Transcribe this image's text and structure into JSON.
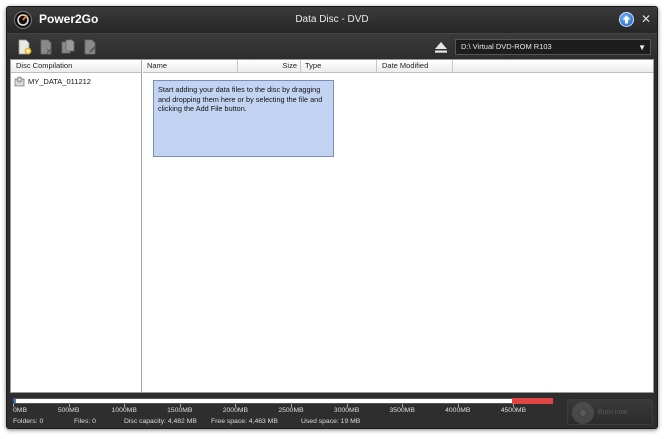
{
  "app": {
    "name": "Power2Go",
    "window_title": "Data Disc - DVD"
  },
  "icons": {
    "logo": "power2go-logo-icon",
    "upgrade": "upgrade-arrow-icon",
    "close": "close-icon",
    "add_file": "add-file-icon",
    "delete": "delete-icon",
    "copy": "copy-icon",
    "edit": "edit-icon",
    "eject": "eject-icon",
    "tree_disc": "disc-folder-icon",
    "burn": "disc-burn-icon"
  },
  "toolbar": {
    "drive": "D:\\ Virtual DVD-ROM R103"
  },
  "left_pane": {
    "header": "Disc Compilation",
    "items": [
      {
        "label": "MY_DATA_011212"
      }
    ]
  },
  "file_list": {
    "columns": [
      "Name",
      "Size",
      "Type",
      "Date Modified"
    ],
    "hint": "Start adding your data files to the disc by dragging and dropping them here or by selecting the file and clicking the Add File button."
  },
  "capacity_bar": {
    "ticks": [
      "0MB",
      "500MB",
      "1000MB",
      "1500MB",
      "2000MB",
      "2500MB",
      "3000MB",
      "3500MB",
      "4000MB",
      "4500MB"
    ],
    "used_fraction": 0.004
  },
  "status": {
    "folders": "Folders: 0",
    "files": "Files: 0",
    "capacity": "Disc capacity: 4,482 MB",
    "free": "Free space: 4,463 MB",
    "used": "Used space: 19 MB"
  },
  "burn": {
    "label": "Burn now"
  },
  "colors": {
    "accent": "#3d7bd9",
    "hint_bg": "#c3d4f2",
    "over_capacity": "#e04545",
    "title_bg": "#2c2c2c"
  }
}
